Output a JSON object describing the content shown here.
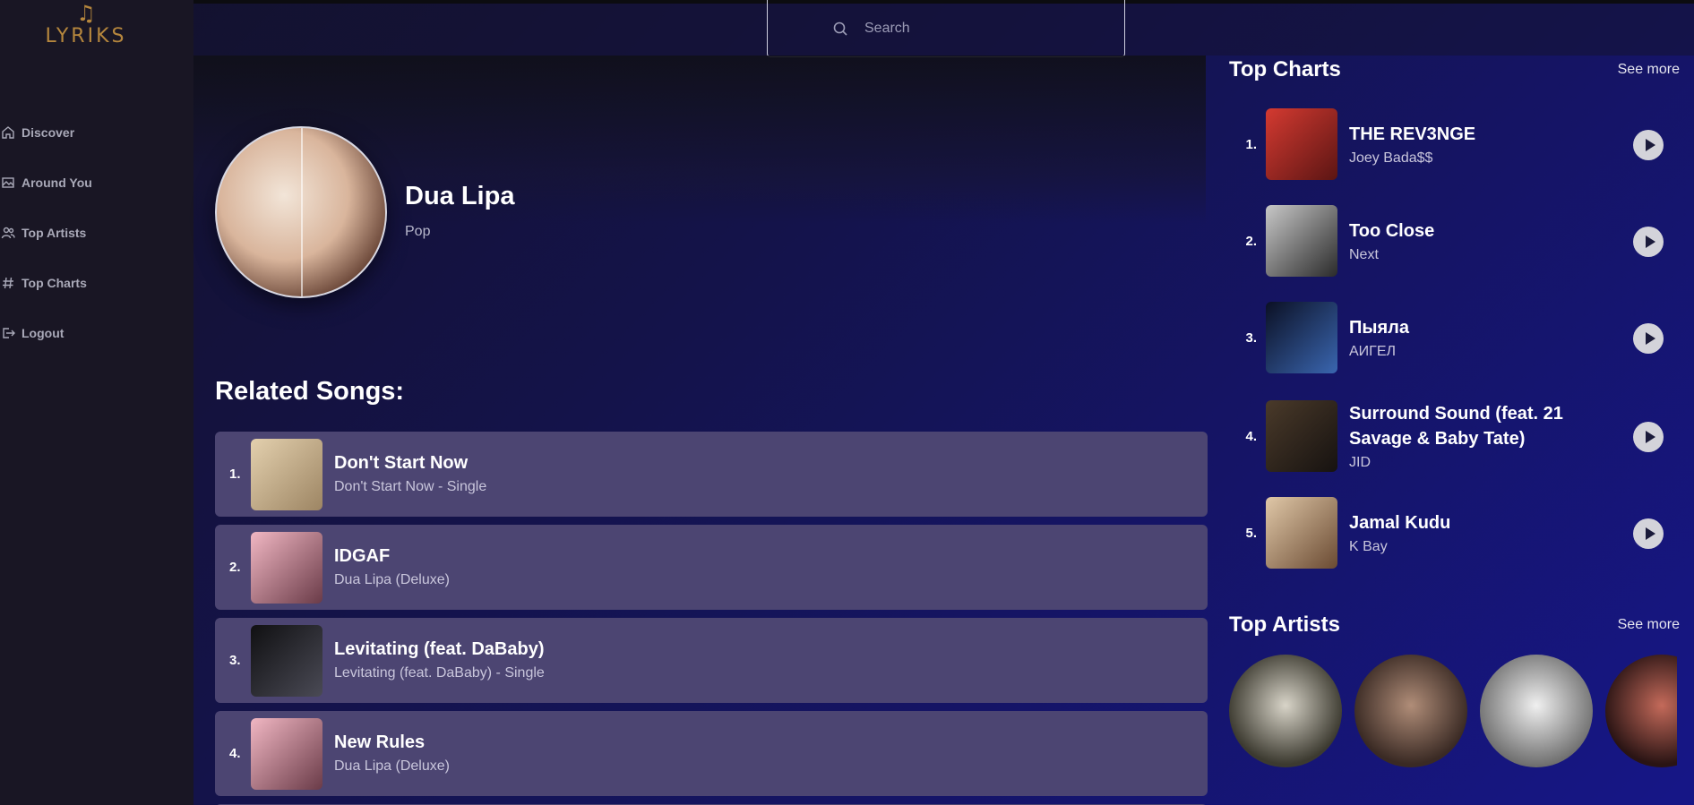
{
  "app": {
    "logo_text": "LYRIKS",
    "logo_glyph": "♫"
  },
  "search": {
    "placeholder": "Search"
  },
  "sidebar": {
    "items": [
      {
        "label": "Discover",
        "icon": "home-icon"
      },
      {
        "label": "Around You",
        "icon": "image-icon"
      },
      {
        "label": "Top Artists",
        "icon": "users-icon"
      },
      {
        "label": "Top Charts",
        "icon": "hash-icon"
      },
      {
        "label": "Logout",
        "icon": "logout-icon"
      }
    ]
  },
  "artist": {
    "name": "Dua Lipa",
    "genre": "Pop"
  },
  "related": {
    "title": "Related Songs:",
    "songs": [
      {
        "num": "1.",
        "title": "Don't Start Now",
        "album": "Don't Start Now - Single",
        "color": "#c9b79b"
      },
      {
        "num": "2.",
        "title": "IDGAF",
        "album": "Dua Lipa (Deluxe)",
        "color": "#d89aa8"
      },
      {
        "num": "3.",
        "title": "Levitating (feat. DaBaby)",
        "album": "Levitating (feat. DaBaby) - Single",
        "color": "#2c2a2f"
      },
      {
        "num": "4.",
        "title": "New Rules",
        "album": "Dua Lipa (Deluxe)",
        "color": "#d89aa8"
      }
    ]
  },
  "top_charts": {
    "title": "Top Charts",
    "see_more": "See more",
    "items": [
      {
        "num": "1.",
        "title": "THE REV3NGE",
        "artist": "Joey Bada$$",
        "color": "#b9302c"
      },
      {
        "num": "2.",
        "title": "Too Close",
        "artist": "Next",
        "color": "#9a9a9a"
      },
      {
        "num": "3.",
        "title": "Пыяла",
        "artist": "АИГЕЛ",
        "color": "#111a33"
      },
      {
        "num": "4.",
        "title": "Surround Sound (feat. 21 Savage & Baby Tate)",
        "artist": "JID",
        "color": "#3b2d22"
      },
      {
        "num": "5.",
        "title": "Jamal Kudu",
        "artist": "K Bay",
        "color": "#b08a6a"
      }
    ]
  },
  "top_artists": {
    "title": "Top Artists",
    "see_more": "See more",
    "colors": [
      "#6d6a5a",
      "#8a6a5a",
      "#a9a9a9",
      "#4a2a2a"
    ]
  }
}
